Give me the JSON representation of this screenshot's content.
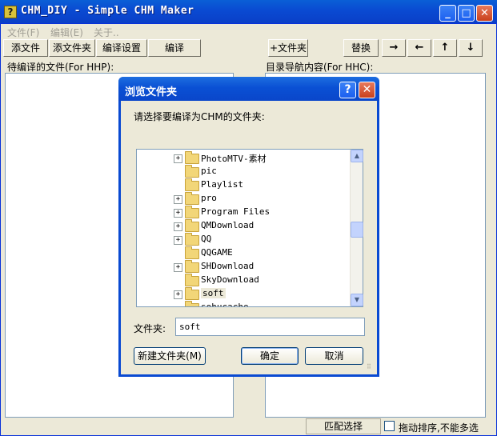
{
  "window": {
    "title": "CHM_DIY - Simple CHM Maker",
    "icon_char": "?",
    "min": "_",
    "max": "□",
    "close": "✕"
  },
  "menu": {
    "file": "文件(F)",
    "edit": "编辑(E)",
    "about": "关于.."
  },
  "toolbar": {
    "add_file": "添文件",
    "add_folder": "添文件夹",
    "compile_settings": "编译设置",
    "compile": "编译",
    "plus_folder": "+文件夹",
    "replace": "替换",
    "right_arrow": "→",
    "left_arrow": "←",
    "up_arrow": "↑",
    "down_arrow": "↓"
  },
  "panes": {
    "left_label": "待编译的文件(For HHP):",
    "right_label": "目录导航内容(For HHC):"
  },
  "status": {
    "match_select": "匹配选择",
    "drag_sort": "拖动排序,不能多选"
  },
  "dialog": {
    "title": "浏览文件夹",
    "help": "?",
    "close": "✕",
    "instruction": "请选择要编译为CHM的文件夹:",
    "folder_label": "文件夹:",
    "folder_value": "soft",
    "new_folder": "新建文件夹(M)",
    "ok": "确定",
    "cancel": "取消",
    "tree": [
      {
        "label": "PhotoMTV-素材",
        "expand": "+"
      },
      {
        "label": "pic",
        "expand": ""
      },
      {
        "label": "Playlist",
        "expand": ""
      },
      {
        "label": "pro",
        "expand": "+"
      },
      {
        "label": "Program Files",
        "expand": "+"
      },
      {
        "label": "QMDownload",
        "expand": "+"
      },
      {
        "label": "QQ",
        "expand": "+"
      },
      {
        "label": "QQGAME",
        "expand": ""
      },
      {
        "label": "SHDownload",
        "expand": "+"
      },
      {
        "label": "SkyDownload",
        "expand": ""
      },
      {
        "label": "soft",
        "expand": "+",
        "selected": true
      },
      {
        "label": "sohucache",
        "expand": ""
      }
    ],
    "scroll_up": "▲",
    "scroll_down": "▼"
  }
}
